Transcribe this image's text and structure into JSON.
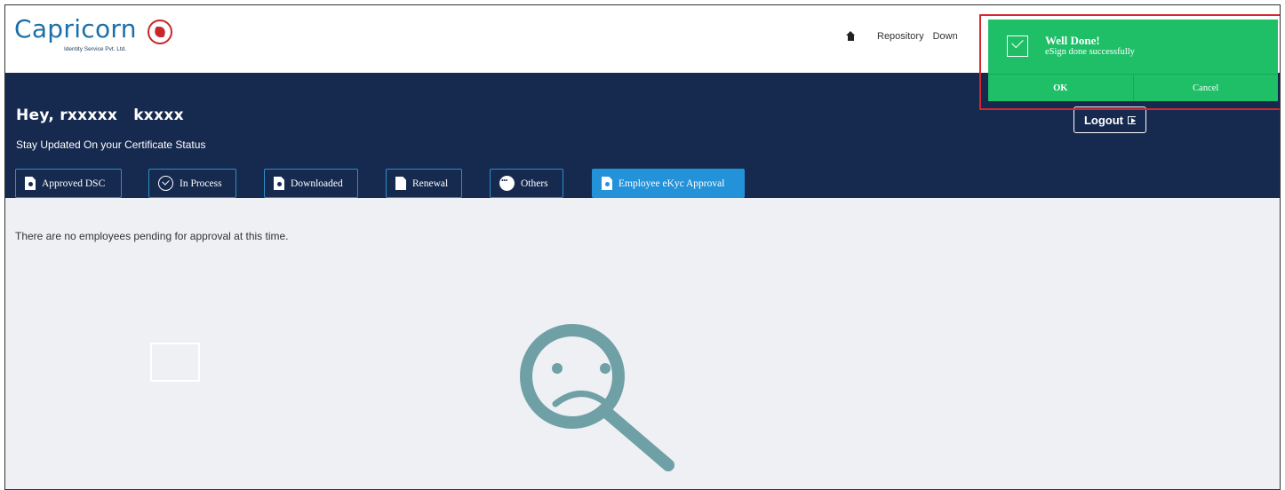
{
  "header": {
    "logo_text": "Capricorn",
    "logo_subtext": "Identity Service Pvt. Ltd.",
    "nav": {
      "repository": "Repository",
      "downloads": "Down"
    }
  },
  "profile": {
    "greeting": "Hey,",
    "first_name": "rxxxxx",
    "last_name": "kxxxx",
    "subtitle": "Stay Updated On your Certificate Status",
    "logout_label": "Logout"
  },
  "tabs": [
    {
      "label": "Approved DSC"
    },
    {
      "label": "In Process"
    },
    {
      "label": "Downloaded"
    },
    {
      "label": "Renewal"
    },
    {
      "label": "Others"
    },
    {
      "label": "Employee eKyc Approval",
      "active": true
    }
  ],
  "content": {
    "empty_message": "There are no employees pending for approval at this time."
  },
  "toast": {
    "title": "Well Done!",
    "message": "eSign done successfully",
    "ok_label": "OK",
    "cancel_label": "Cancel"
  },
  "colors": {
    "header_band": "#16294f",
    "active_tab": "#2492d8",
    "toast": "#1fbf68",
    "highlight": "#d6262e",
    "illustration": "#6fa0a6"
  },
  "icons": [
    "home-icon",
    "logout-icon",
    "document-icon",
    "clock-check-icon",
    "more-dots-icon",
    "check-icon",
    "sad-search-icon"
  ]
}
